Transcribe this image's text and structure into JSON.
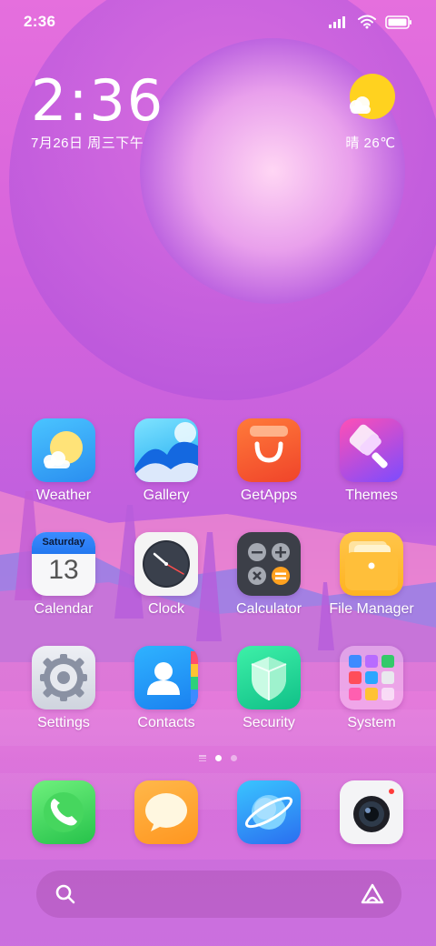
{
  "status_bar": {
    "time": "2:36"
  },
  "clock_widget": {
    "time": "2:36",
    "date": "7月26日 周三下午"
  },
  "weather_widget": {
    "text": "晴 26℃"
  },
  "apps": [
    {
      "label": "Weather"
    },
    {
      "label": "Gallery"
    },
    {
      "label": "GetApps"
    },
    {
      "label": "Themes"
    },
    {
      "label": "Calendar",
      "calendar_day": "Saturday",
      "calendar_date": "13"
    },
    {
      "label": "Clock"
    },
    {
      "label": "Calculator"
    },
    {
      "label": "File Manager"
    },
    {
      "label": "Settings"
    },
    {
      "label": "Contacts"
    },
    {
      "label": "Security"
    },
    {
      "label": "System"
    }
  ],
  "dock": [
    {
      "icon": "phone-icon"
    },
    {
      "icon": "messages-icon"
    },
    {
      "icon": "browser-icon"
    },
    {
      "icon": "camera-icon"
    }
  ],
  "page_indicator": {
    "pages": 2,
    "active": 0
  },
  "search": {
    "left_icon": "search-icon",
    "right_icon": "assistant-icon"
  },
  "colors": {
    "accent": "#e56fdd",
    "weather_sun": "#ffd21f"
  }
}
